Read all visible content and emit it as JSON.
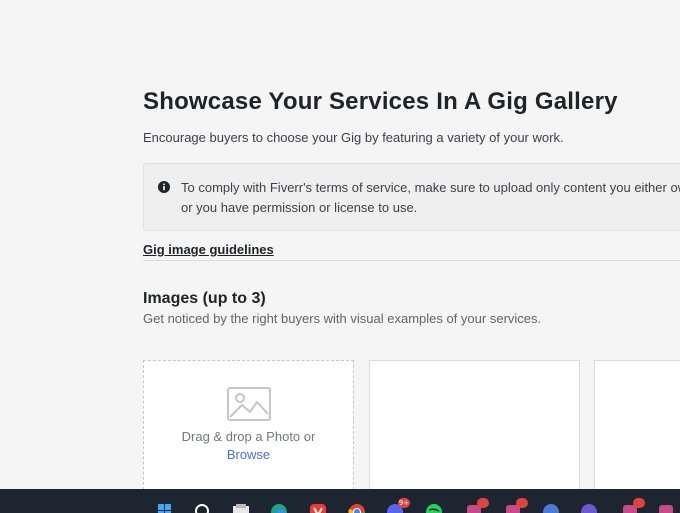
{
  "header": {
    "title": "Showcase Your Services In A Gig Gallery",
    "subtitle": "Encourage buyers to choose your Gig by featuring a variety of your work."
  },
  "notice": {
    "icon": "info-icon",
    "text": "To comply with Fiverr's terms of service, make sure to upload only content you either own or you have permission or license to use."
  },
  "guidelines_link": "Gig image guidelines",
  "images_section": {
    "title": "Images (up to 3)",
    "description": "Get noticed by the right buyers with visual examples of your services.",
    "dropzone": {
      "icon": "photo-icon",
      "text": "Drag & drop a Photo or",
      "browse_label": "Browse"
    }
  },
  "taskbar": {
    "icons": [
      "windows-start-icon",
      "search-icon",
      "file-explorer-icon",
      "edge-browser-icon",
      "vivaldi-icon",
      "chrome-icon",
      "discord-icon",
      "spotify-icon",
      "app-icon",
      "app-icon",
      "app-icon",
      "app-icon",
      "app-icon",
      "app-icon"
    ],
    "discord_badge": "9+"
  },
  "colors": {
    "background": "#f5f5f5",
    "link": "#446ee7",
    "taskbar": "#1c2530"
  }
}
